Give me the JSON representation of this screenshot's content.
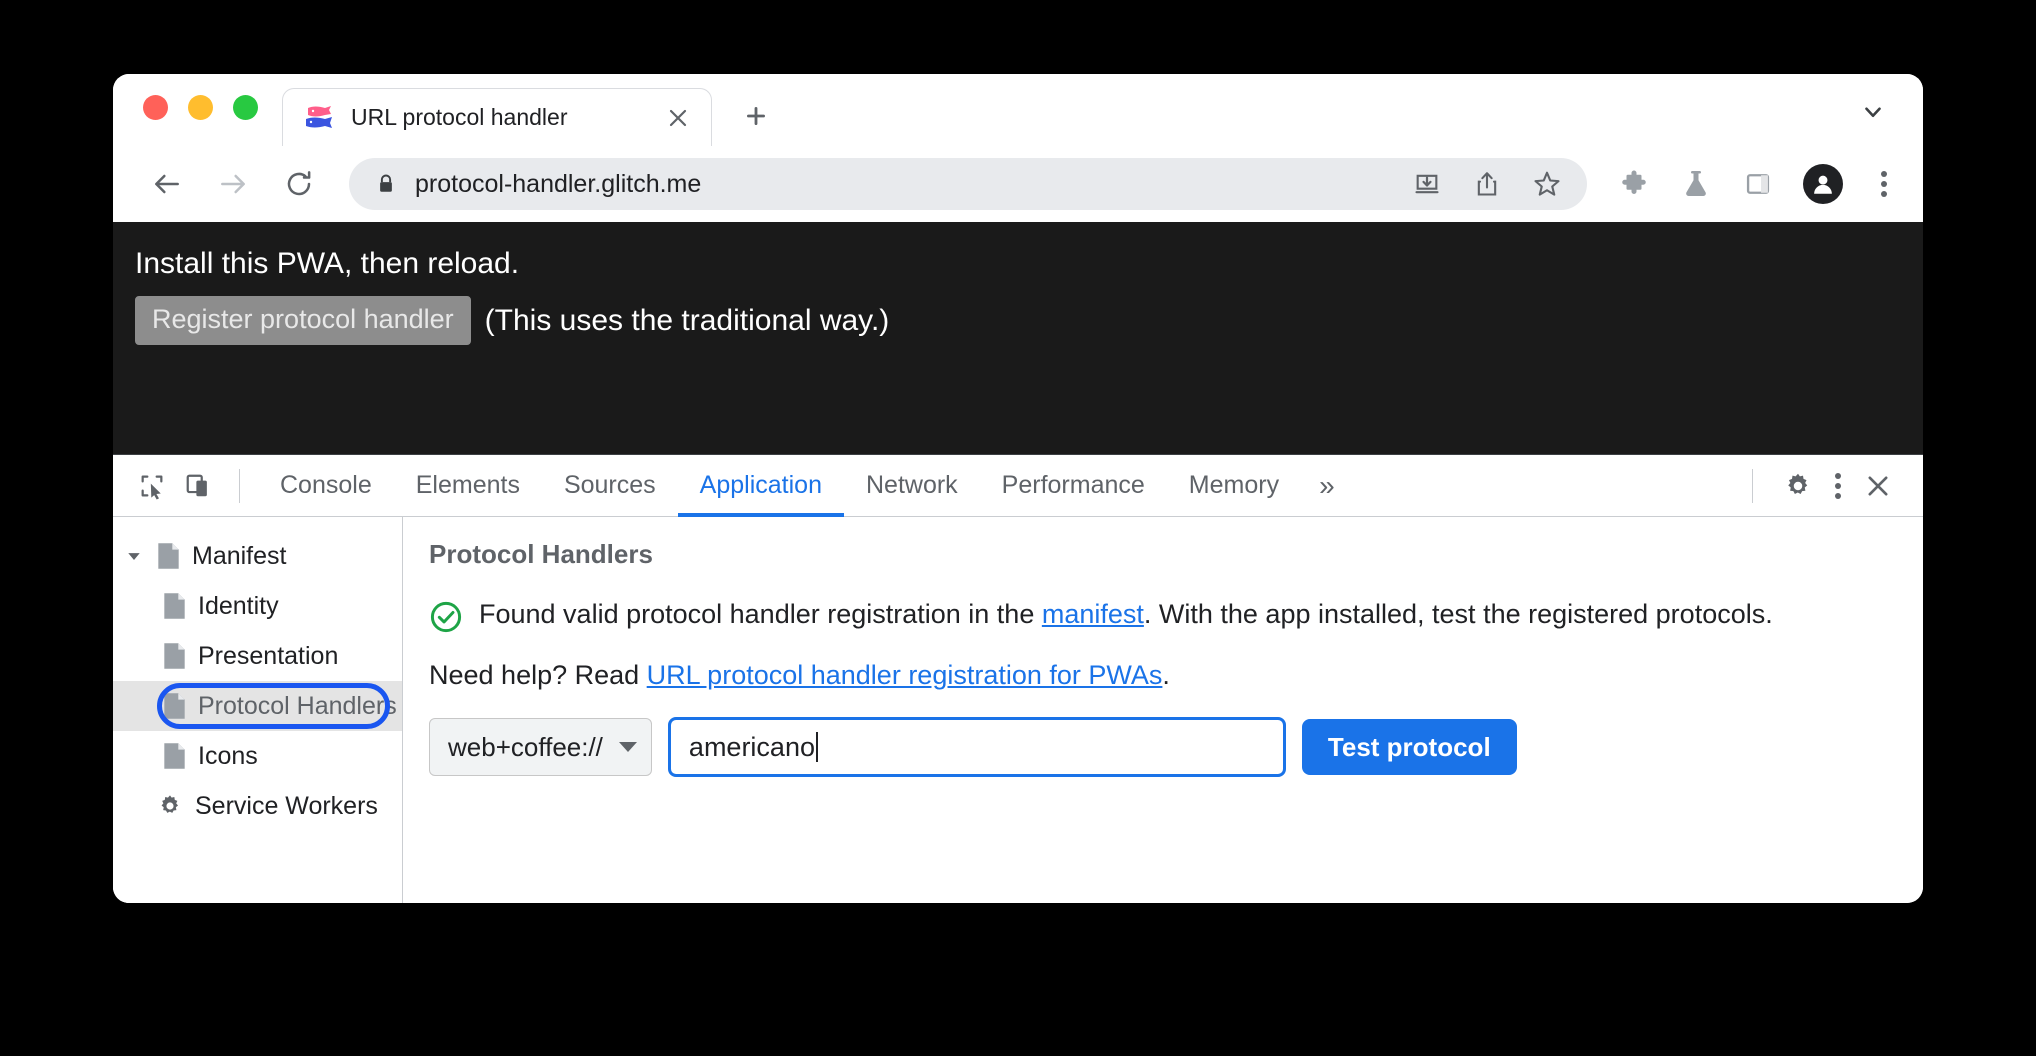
{
  "window": {
    "traffic_lights": [
      "close",
      "minimize",
      "maximize"
    ]
  },
  "tabstrip": {
    "tab": {
      "title": "URL protocol handler",
      "favicon": "glitch-fish-favicon",
      "close_label": "✕"
    },
    "new_tab_label": "+",
    "tab_search_label": "tab-search"
  },
  "toolbar": {
    "back": "back-arrow",
    "forward": "forward-arrow",
    "reload": "reload",
    "url": "protocol-handler.glitch.me",
    "lock": "lock-icon",
    "omnibox_actions": [
      "install-pwa-icon",
      "share-icon",
      "bookmark-star-icon"
    ],
    "right_actions": [
      "extensions-puzzle-icon",
      "experiments-flask-icon",
      "side-panel-icon",
      "profile-avatar",
      "chrome-menu-kebab"
    ]
  },
  "page": {
    "heading": "Install this PWA, then reload.",
    "register_button": "Register protocol handler",
    "note": "(This uses the traditional way.)"
  },
  "devtools": {
    "left_icons": [
      "inspect-element-icon",
      "device-toolbar-icon"
    ],
    "tabs": [
      {
        "label": "Console",
        "active": false
      },
      {
        "label": "Elements",
        "active": false
      },
      {
        "label": "Sources",
        "active": false
      },
      {
        "label": "Application",
        "active": true
      },
      {
        "label": "Network",
        "active": false
      },
      {
        "label": "Performance",
        "active": false
      },
      {
        "label": "Memory",
        "active": false
      }
    ],
    "more_tabs_label": "»",
    "right_icons": [
      "settings-gear-icon",
      "devtools-kebab-icon",
      "close-devtools-icon"
    ],
    "sidebar": [
      {
        "label": "Manifest",
        "icon": "document-icon",
        "twisty": "expanded",
        "indent": false,
        "selected": false
      },
      {
        "label": "Identity",
        "icon": "document-icon",
        "twisty": "none",
        "indent": true,
        "selected": false
      },
      {
        "label": "Presentation",
        "icon": "document-icon",
        "twisty": "none",
        "indent": true,
        "selected": false
      },
      {
        "label": "Protocol Handlers",
        "icon": "document-icon",
        "twisty": "none",
        "indent": true,
        "selected": true
      },
      {
        "label": "Icons",
        "icon": "document-icon",
        "twisty": "none",
        "indent": true,
        "selected": false
      },
      {
        "label": "Service Workers",
        "icon": "gear-icon",
        "twisty": "none",
        "indent": false,
        "selected": false
      }
    ],
    "panel": {
      "title": "Protocol Handlers",
      "status_icon": "green-check-circle-icon",
      "status_text_1": "Found valid protocol handler registration in the ",
      "status_link": "manifest",
      "status_text_2": ". With the app installed, test the registered protocols.",
      "help_text": "Need help? Read ",
      "help_link": "URL protocol handler registration for PWAs",
      "help_suffix": ".",
      "scheme_value": "web+coffee://",
      "scheme_options": [
        "web+coffee://"
      ],
      "input_value": "americano",
      "input_placeholder": "",
      "test_button": "Test protocol"
    }
  },
  "colors": {
    "accent_blue": "#1a73e8",
    "highlight_ring": "#1a56f0",
    "success_green": "#1ea446",
    "page_bg": "#1a1a1a"
  }
}
